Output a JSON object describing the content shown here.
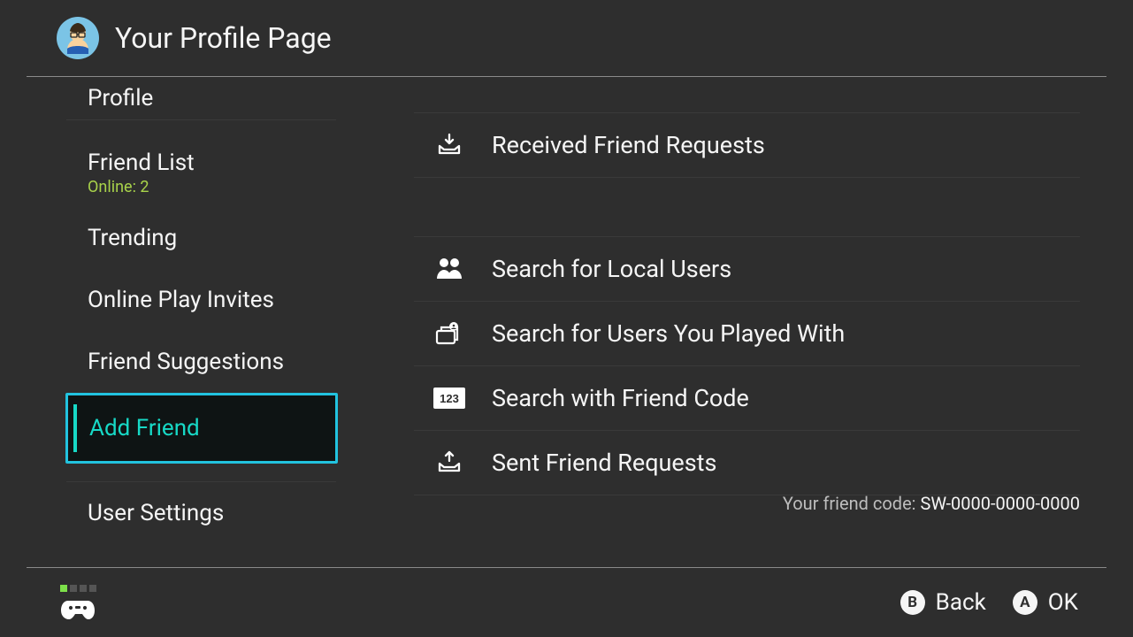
{
  "header": {
    "title": "Your Profile Page"
  },
  "sidebar": {
    "items": [
      {
        "label": "Profile"
      },
      {
        "label": "Friend List",
        "subtext": "Online: 2"
      },
      {
        "label": "Trending"
      },
      {
        "label": "Online Play Invites"
      },
      {
        "label": "Friend Suggestions"
      },
      {
        "label": "Add Friend"
      },
      {
        "label": "User Settings"
      }
    ],
    "selected_index": 5
  },
  "main": {
    "rows": [
      {
        "label": "Received Friend Requests"
      },
      {
        "label": "Search for Local Users"
      },
      {
        "label": "Search for Users You Played With"
      },
      {
        "label": "Search with Friend Code"
      },
      {
        "label": "Sent Friend Requests"
      }
    ],
    "friend_code_prefix": "Your friend code: ",
    "friend_code_value": "SW-0000-0000-0000"
  },
  "footer": {
    "back_glyph": "B",
    "back_label": "Back",
    "ok_glyph": "A",
    "ok_label": "OK"
  }
}
